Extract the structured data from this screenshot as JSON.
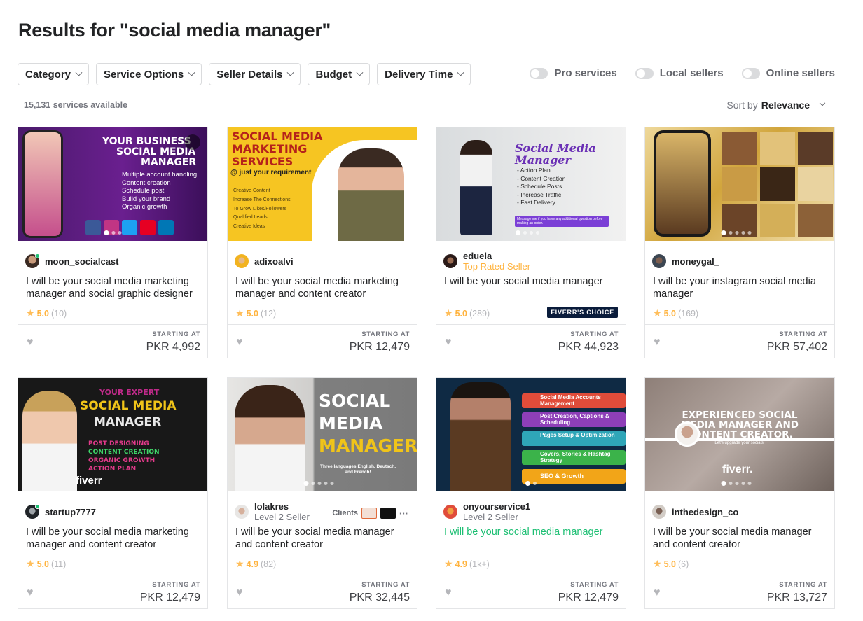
{
  "page_title": "Results for \"social media manager\"",
  "filters": [
    "Category",
    "Service Options",
    "Seller Details",
    "Budget",
    "Delivery Time"
  ],
  "toggles": [
    "Pro services",
    "Local sellers",
    "Online sellers"
  ],
  "services_count": "15,131 services available",
  "sort": {
    "label": "Sort by",
    "value": "Relevance"
  },
  "price_label": "STARTING AT",
  "fiverrs_choice": "FIVERR'S CHOICE",
  "clients_label": "Clients",
  "colors": {
    "accent_green": "#1dbf73",
    "rating_star": "#ffbe5b",
    "top_rated": "#ffb33e"
  },
  "gigs": [
    {
      "seller": "moon_socialcast",
      "level": "",
      "title": "I will be your social media marketing manager and social graphic designer",
      "rating": "5.0",
      "reviews": "(10)",
      "price": "PKR 4,992",
      "thumb": {
        "lines": [
          "YOUR BUSINESS",
          "SOCIAL MEDIA",
          "MANAGER"
        ],
        "bullets": [
          "Multiple account handling",
          "Content creation",
          "Schedule post",
          "Build your brand",
          "Organic growth"
        ]
      }
    },
    {
      "seller": "adixoalvi",
      "level": "",
      "title": "I will be your social media marketing manager and content creator",
      "rating": "5.0",
      "reviews": "(12)",
      "price": "PKR 12,479",
      "thumb": {
        "lines": [
          "SOCIAL MEDIA",
          "MARKETING",
          "SERVICES"
        ],
        "sub": "@ just your requirement",
        "bullets": [
          "Creative Content",
          "Increase The Connections",
          "To Grow Likes/Followers",
          "Qualified Leads",
          "Creative Ideas"
        ]
      }
    },
    {
      "seller": "eduela",
      "level": "Top Rated Seller",
      "title": "I will be your social media manager",
      "rating": "5.0",
      "reviews": "(289)",
      "price": "PKR 44,923",
      "choice": true,
      "thumb": {
        "lines": [
          "Social Media Manager"
        ],
        "bullets": [
          "- Action Plan",
          "- Content Creation",
          "- Schedule Posts",
          "- Increase Traffic",
          "- Fast Delivery"
        ],
        "note": "Message me if you have any additional question before making an order."
      }
    },
    {
      "seller": "moneygal_",
      "level": "",
      "title": "I will be your instagram social media manager",
      "rating": "5.0",
      "reviews": "(169)",
      "price": "PKR 57,402",
      "thumb": {
        "lines": []
      }
    },
    {
      "seller": "startup7777",
      "level": "",
      "title": "I will be your social media marketing manager and content creator",
      "rating": "5.0",
      "reviews": "(11)",
      "price": "PKR 12,479",
      "thumb": {
        "lines": [
          "YOUR EXPERT",
          "SOCIAL MEDIA",
          "MANAGER"
        ],
        "bullets": [
          "POST DESIGNING",
          "CONTENT CREATION",
          "ORGANIC GROWTH",
          "ACTION PLAN"
        ],
        "brand": "fiverr"
      }
    },
    {
      "seller": "lolakres",
      "level": "Level 2 Seller",
      "title": "I will be your social media manager and content creator",
      "rating": "4.9",
      "reviews": "(82)",
      "price": "PKR 32,445",
      "clients": true,
      "thumb": {
        "lines": [
          "SOCIAL",
          "MEDIA",
          "MANAGER"
        ],
        "sub": "Three languages English, Deutsch, and French!"
      }
    },
    {
      "seller": "onyourservice1",
      "level": "Level 2 Seller",
      "title": "I will be your social media manager",
      "rating": "4.9",
      "reviews": "(1k+)",
      "price": "PKR 12,479",
      "hover": true,
      "thumb": {
        "lines": [],
        "bullets": [
          "Social Media Accounts Management",
          "Post Creation, Captions & Scheduling",
          "Pages Setup & Optimization",
          "Covers, Stories & Hashtag Strategy",
          "SEO & Growth"
        ]
      }
    },
    {
      "seller": "inthedesign_co",
      "level": "",
      "title": "I will be your social media manager and content creator",
      "rating": "5.0",
      "reviews": "(6)",
      "price": "PKR 13,727",
      "thumb": {
        "lines": [
          "EXPERIENCED SOCIAL",
          "MEDIA MANAGER AND",
          "CONTENT CREATOR."
        ],
        "sub": "Let's upgrade your socials!",
        "brand": "fiverr."
      }
    }
  ]
}
